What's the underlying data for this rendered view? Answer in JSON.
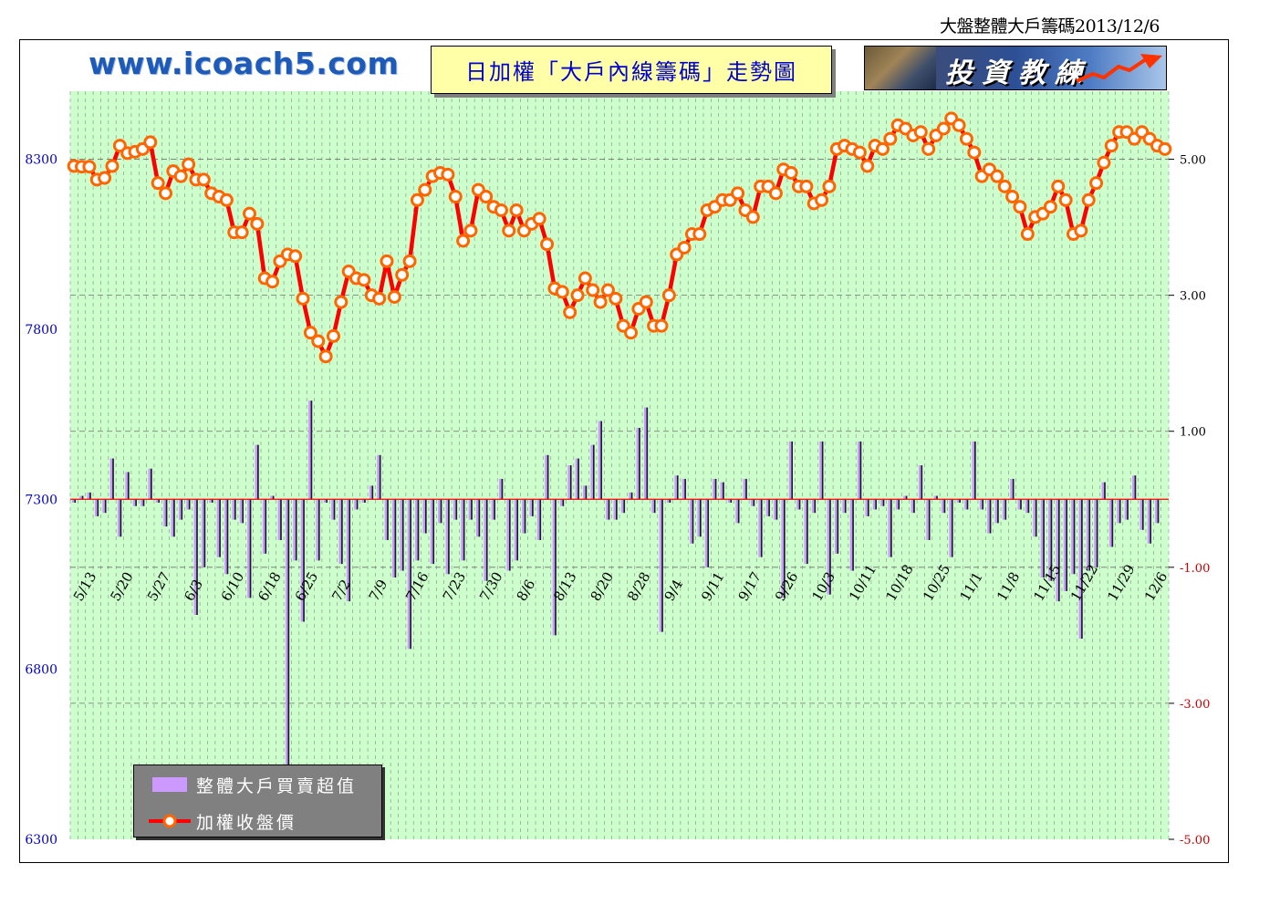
{
  "header": {
    "date_label": "大盤整體大戶籌碼2013/12/6"
  },
  "site_logo": "www.icoach5.com",
  "title": "日加權「大戶內線籌碼」走勢圖",
  "badge": {
    "text": "投資教練"
  },
  "colors": {
    "plot_bg": "#ccffcc",
    "line": "#ff0000",
    "marker_fill": "#ffffff",
    "marker_edge": "#ff6600",
    "bar_fill": "#cc99ff",
    "bar_shadow": "#1a1a2e",
    "left_axis_text": "#0000cc",
    "right_axis_text": "#000000",
    "right_axis_neg": "#cc0000",
    "zero_line": "#ff0000"
  },
  "legend": {
    "bar_label": "整體大戶買賣超值",
    "line_label": "加權收盤價",
    "placement": "bottom-left"
  },
  "chart_data": {
    "type": "bar+line",
    "title": "日加權「大戶內線籌碼」走勢圖",
    "left_axis": {
      "ticks": [
        "8300",
        "7800",
        "7300",
        "6800",
        "6300"
      ],
      "ylim": [
        6300,
        8500
      ]
    },
    "right_axis": {
      "ticks": [
        "5.00",
        "3.00",
        "1.00",
        "-1.00",
        "-3.00",
        "-5.00"
      ],
      "ylim": [
        -5,
        6
      ]
    },
    "x_tick_labels": [
      "5/13",
      "5/20",
      "5/27",
      "6/3",
      "6/10",
      "6/18",
      "6/25",
      "7/2",
      "7/9",
      "7/16",
      "7/23",
      "7/30",
      "8/6",
      "8/13",
      "8/20",
      "8/28",
      "9/4",
      "9/11",
      "9/17",
      "9/26",
      "10/3",
      "10/11",
      "10/18",
      "10/25",
      "11/1",
      "11/8",
      "11/15",
      "11/22",
      "11/29",
      "12/6"
    ],
    "series": [
      {
        "name": "加權收盤價",
        "axis": "left",
        "values": [
          8280,
          8278,
          8278,
          8240,
          8245,
          8280,
          8340,
          8318,
          8322,
          8330,
          8350,
          8230,
          8200,
          8265,
          8250,
          8285,
          8240,
          8240,
          8200,
          8190,
          8180,
          8085,
          8085,
          8140,
          8110,
          7950,
          7940,
          8000,
          8020,
          8015,
          7890,
          7790,
          7765,
          7720,
          7780,
          7880,
          7970,
          7950,
          7945,
          7900,
          7890,
          8000,
          7895,
          7960,
          8000,
          8180,
          8210,
          8250,
          8260,
          8255,
          8190,
          8060,
          8090,
          8210,
          8190,
          8160,
          8150,
          8090,
          8150,
          8090,
          8110,
          8125,
          8050,
          7920,
          7910,
          7850,
          7900,
          7950,
          7915,
          7880,
          7915,
          7890,
          7810,
          7790,
          7860,
          7880,
          7810,
          7810,
          7900,
          8020,
          8040,
          8080,
          8080,
          8150,
          8160,
          8180,
          8180,
          8200,
          8150,
          8130,
          8220,
          8220,
          8200,
          8270,
          8260,
          8220,
          8220,
          8170,
          8180,
          8220,
          8330,
          8340,
          8330,
          8320,
          8280,
          8340,
          8330,
          8360,
          8400,
          8390,
          8370,
          8380,
          8330,
          8370,
          8390,
          8420,
          8400,
          8360,
          8320,
          8250,
          8270,
          8250,
          8220,
          8190,
          8160,
          8080,
          8130,
          8140,
          8160,
          8220,
          8180,
          8080,
          8090,
          8180,
          8230,
          8290,
          8340,
          8380,
          8380,
          8360,
          8380,
          8360,
          8340,
          8330
        ]
      },
      {
        "name": "整體大戶買賣超值",
        "axis": "right",
        "values": [
          -0.05,
          0.05,
          0.1,
          -0.25,
          -0.2,
          0.6,
          -0.55,
          0.4,
          -0.1,
          -0.1,
          0.45,
          -0.05,
          -0.4,
          -0.55,
          -0.3,
          -0.15,
          -1.7,
          -1.0,
          -0.05,
          -0.85,
          -1.1,
          -0.3,
          -0.35,
          -1.45,
          0.8,
          -0.8,
          0.05,
          -0.6,
          -3.9,
          -0.9,
          -1.8,
          1.45,
          -0.9,
          -0.05,
          -0.3,
          -0.95,
          -1.5,
          -0.15,
          -0.05,
          0.2,
          0.65,
          -0.6,
          -1.15,
          -1.05,
          -2.2,
          -0.9,
          -0.5,
          -0.95,
          -0.35,
          -1.1,
          -0.3,
          -0.9,
          -0.3,
          -0.55,
          -1.2,
          -0.3,
          0.3,
          -1.05,
          -0.9,
          -0.5,
          -0.25,
          -0.6,
          0.65,
          -2.0,
          -0.1,
          0.5,
          0.6,
          0.2,
          0.8,
          1.15,
          -0.3,
          -0.3,
          -0.2,
          0.1,
          1.05,
          1.35,
          -0.2,
          -1.95,
          -0.05,
          0.35,
          0.3,
          -0.65,
          -0.55,
          -1.0,
          0.3,
          0.25,
          -0.05,
          -0.35,
          0.3,
          -0.1,
          -0.85,
          -0.25,
          -0.3,
          -1.45,
          0.85,
          -0.15,
          -0.95,
          -0.2,
          0.85,
          -1.4,
          -0.8,
          -0.2,
          -1.05,
          0.85,
          -0.25,
          -0.15,
          -0.1,
          -0.85,
          -0.15,
          0.05,
          -0.2,
          0.5,
          -0.6,
          0.05,
          -0.2,
          -0.85,
          -0.05,
          -0.15,
          0.85,
          -0.15,
          -0.5,
          -0.35,
          -0.3,
          0.3,
          -0.15,
          -0.2,
          -0.55,
          -1.15,
          -1.2,
          -1.5,
          -1.35,
          -1.1,
          -2.05,
          -1.05,
          -1.0,
          0.25,
          -0.7,
          -0.35,
          -0.3,
          0.35,
          -0.45,
          -0.65,
          -0.35
        ]
      }
    ]
  }
}
